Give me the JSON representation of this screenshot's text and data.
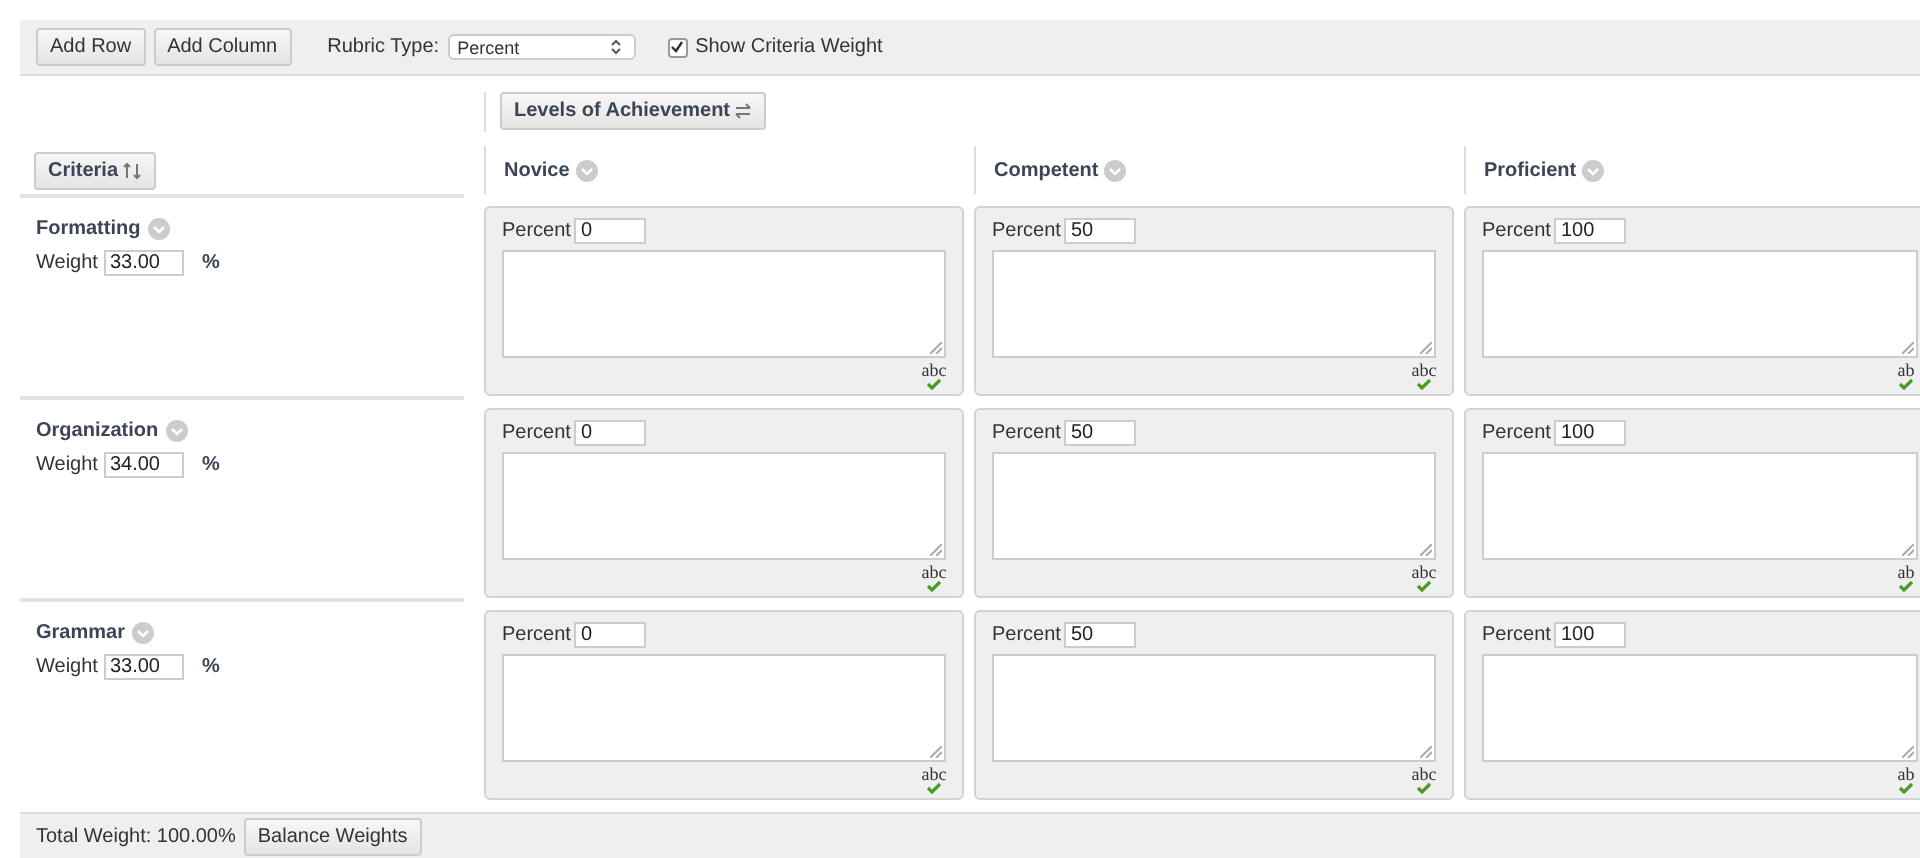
{
  "toolbar": {
    "buttons": [
      "Add Row",
      "Add Column"
    ],
    "rubric_type": {
      "label": "Rubric Type:",
      "value": "Percent"
    },
    "show_weight": {
      "label": "Show Criteria Weight",
      "checked": true
    }
  },
  "levels_button": "Levels of Achievement",
  "criteria_button": "Criteria",
  "levels": [
    {
      "name": "Novice"
    },
    {
      "name": "Competent"
    },
    {
      "name": "Proficient"
    }
  ],
  "criteria": [
    {
      "name": "Formatting",
      "weight_label": "Weight",
      "weight": "33.00",
      "unit": "%",
      "cells": [
        {
          "label": "Percent",
          "value": "0",
          "spellcheck": "abc"
        },
        {
          "label": "Percent",
          "value": "50",
          "spellcheck": "abc"
        },
        {
          "label": "Percent",
          "value": "100",
          "spellcheck": "ab"
        }
      ]
    },
    {
      "name": "Organization",
      "weight_label": "Weight",
      "weight": "34.00",
      "unit": "%",
      "cells": [
        {
          "label": "Percent",
          "value": "0",
          "spellcheck": "abc"
        },
        {
          "label": "Percent",
          "value": "50",
          "spellcheck": "abc"
        },
        {
          "label": "Percent",
          "value": "100",
          "spellcheck": "ab"
        }
      ]
    },
    {
      "name": "Grammar",
      "weight_label": "Weight",
      "weight": "33.00",
      "unit": "%",
      "cells": [
        {
          "label": "Percent",
          "value": "0",
          "spellcheck": "abc"
        },
        {
          "label": "Percent",
          "value": "50",
          "spellcheck": "abc"
        },
        {
          "label": "Percent",
          "value": "100",
          "spellcheck": "ab"
        }
      ]
    }
  ],
  "footer": {
    "total": "Total Weight: 100.00%",
    "button": "Balance Weights"
  }
}
